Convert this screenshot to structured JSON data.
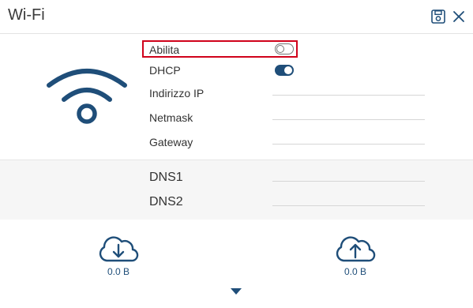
{
  "header": {
    "title": "Wi-Fi"
  },
  "fields": {
    "abilita": {
      "label": "Abilita",
      "enabled": false
    },
    "dhcp": {
      "label": "DHCP",
      "enabled": true
    },
    "ip": {
      "label": "Indirizzo IP",
      "value": ""
    },
    "netmask": {
      "label": "Netmask",
      "value": ""
    },
    "gateway": {
      "label": "Gateway",
      "value": ""
    }
  },
  "dns": {
    "dns1": {
      "label": "DNS1",
      "value": ""
    },
    "dns2": {
      "label": "DNS2",
      "value": ""
    }
  },
  "traffic": {
    "download": "0.0 B",
    "upload": "0.0 B"
  },
  "colors": {
    "accent": "#1f4e79",
    "highlight": "#d0021b"
  },
  "icons": {
    "header_save": "save-icon",
    "header_close": "close-icon",
    "main": "wifi-icon",
    "download": "cloud-download-icon",
    "upload": "cloud-upload-icon",
    "expand": "chevron-down-icon"
  }
}
